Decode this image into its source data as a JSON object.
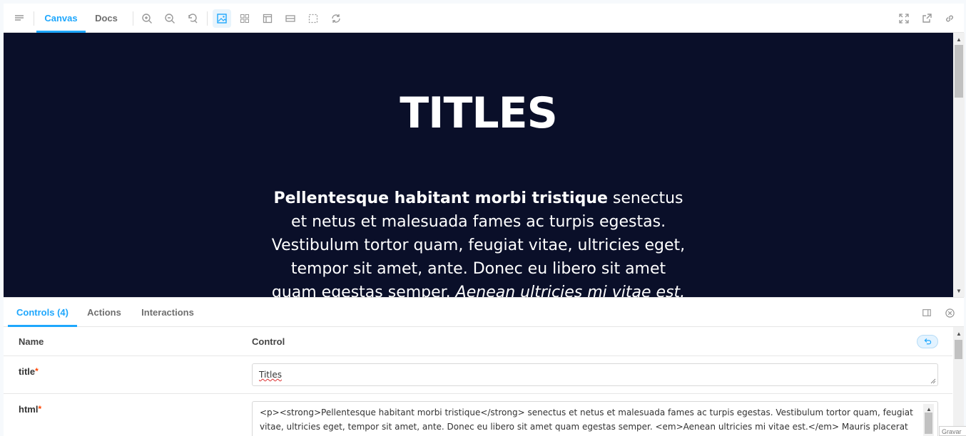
{
  "toolbar": {
    "tabs": [
      "Canvas",
      "Docs"
    ],
    "active_tab": "Canvas",
    "icons_left": [
      "sidebar-toggle",
      "zoom-in",
      "zoom-out",
      "zoom-reset",
      "background",
      "grid",
      "viewport",
      "measure",
      "outline",
      "remount"
    ],
    "icons_right": [
      "fullscreen",
      "open-new-tab",
      "copy-link"
    ]
  },
  "preview": {
    "title": "TITLES",
    "body_strong": "Pellentesque habitant morbi tristique",
    "body_text": " senectus et netus et malesuada fames ac turpis egestas. Vestibulum tortor quam, feugiat vitae, ultricies eget, tempor sit amet, ante. Donec eu libero sit amet quam egestas semper. ",
    "body_em": "Aenean ultricies mi vitae est.",
    "background_color": "#0a0f29"
  },
  "addons": {
    "tabs": [
      "Controls (4)",
      "Actions",
      "Interactions"
    ],
    "active_tab": "Controls (4)",
    "table": {
      "col_name": "Name",
      "col_control": "Control"
    },
    "controls": [
      {
        "name": "title",
        "required": "*",
        "value": "Titles"
      },
      {
        "name": "html",
        "required": "*",
        "value": "<p><strong>Pellentesque habitant morbi tristique</strong> senectus et netus et malesuada fames ac turpis egestas. Vestibulum tortor quam, feugiat vitae, ultricies eget, tempor sit amet, ante. Donec eu libero sit amet quam egestas semper. <em>Aenean ultricies mi vitae est.</em> Mauris placerat eleifend leo."
      }
    ]
  },
  "toast": "Gravar",
  "accent_color": "#1ea7fd"
}
